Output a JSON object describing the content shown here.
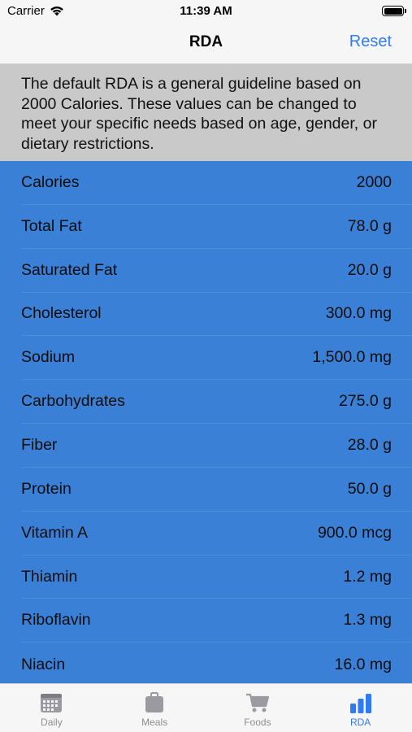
{
  "status_bar": {
    "carrier": "Carrier",
    "time": "11:39 AM"
  },
  "nav": {
    "title": "RDA",
    "reset_label": "Reset"
  },
  "info_text": "The default RDA is a general guideline based on 2000 Calories. These values can be changed to meet your specific needs based on age, gender, or dietary restrictions.",
  "nutrients": [
    {
      "name": "Calories",
      "value": "2000"
    },
    {
      "name": "Total Fat",
      "value": "78.0 g"
    },
    {
      "name": "Saturated Fat",
      "value": "20.0 g"
    },
    {
      "name": "Cholesterol",
      "value": "300.0 mg"
    },
    {
      "name": "Sodium",
      "value": "1,500.0 mg"
    },
    {
      "name": "Carbohydrates",
      "value": "275.0 g"
    },
    {
      "name": "Fiber",
      "value": "28.0 g"
    },
    {
      "name": "Protein",
      "value": "50.0 g"
    },
    {
      "name": "Vitamin A",
      "value": "900.0 mcg"
    },
    {
      "name": "Thiamin",
      "value": "1.2 mg"
    },
    {
      "name": "Riboflavin",
      "value": "1.3 mg"
    },
    {
      "name": "Niacin",
      "value": "16.0 mg"
    }
  ],
  "tabs": [
    {
      "label": "Daily",
      "icon": "calendar-icon"
    },
    {
      "label": "Meals",
      "icon": "lunchbox-icon"
    },
    {
      "label": "Foods",
      "icon": "cart-icon"
    },
    {
      "label": "RDA",
      "icon": "bar-chart-icon",
      "active": true
    }
  ],
  "colors": {
    "accent": "#2f7bf5",
    "list_background": "#3a80d6",
    "info_background": "#c9c9c9"
  }
}
